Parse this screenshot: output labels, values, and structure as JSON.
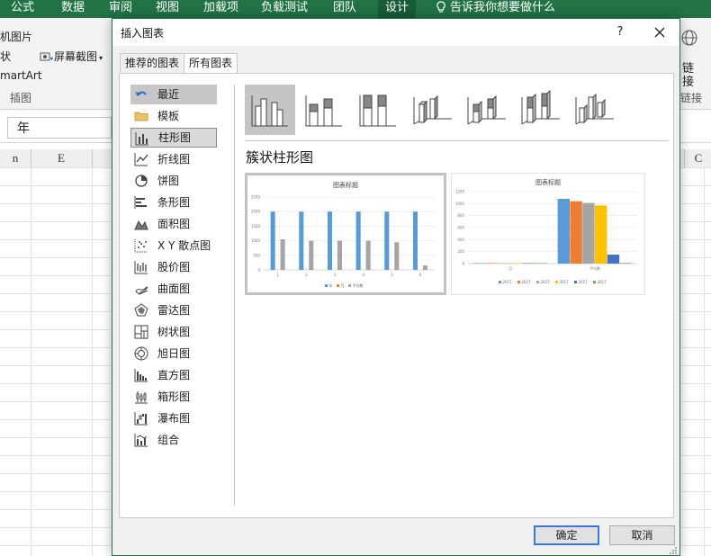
{
  "ribbon": {
    "tabs": [
      "公式",
      "数据",
      "审阅",
      "视图",
      "加载项",
      "负载测试",
      "团队",
      "设计"
    ],
    "tell_me": "告诉我你想要做什么",
    "left_items": [
      "机图片",
      "状",
      "屏幕截图",
      "martArt",
      "插图"
    ],
    "right_items": [
      "链",
      "接",
      "链接"
    ]
  },
  "formula_bar": {
    "namebox_value": "年"
  },
  "columns": [
    "n",
    "E"
  ],
  "right_col": "C",
  "dialog": {
    "title": "插入图表",
    "help": "?",
    "tabs": [
      "推荐的图表",
      "所有图表"
    ],
    "categories": [
      {
        "label": "最近",
        "icon": "undo-arrow-icon"
      },
      {
        "label": "模板",
        "icon": "folder-icon"
      },
      {
        "label": "柱形图",
        "icon": "column-chart-icon"
      },
      {
        "label": "折线图",
        "icon": "line-chart-icon"
      },
      {
        "label": "饼图",
        "icon": "pie-chart-icon"
      },
      {
        "label": "条形图",
        "icon": "bar-chart-icon"
      },
      {
        "label": "面积图",
        "icon": "area-chart-icon"
      },
      {
        "label": "X Y 散点图",
        "icon": "scatter-chart-icon"
      },
      {
        "label": "股价图",
        "icon": "stock-chart-icon"
      },
      {
        "label": "曲面图",
        "icon": "surface-chart-icon"
      },
      {
        "label": "雷达图",
        "icon": "radar-chart-icon"
      },
      {
        "label": "树状图",
        "icon": "treemap-chart-icon"
      },
      {
        "label": "旭日图",
        "icon": "sunburst-chart-icon"
      },
      {
        "label": "直方图",
        "icon": "histogram-chart-icon"
      },
      {
        "label": "箱形图",
        "icon": "box-whisker-icon"
      },
      {
        "label": "瀑布图",
        "icon": "waterfall-chart-icon"
      },
      {
        "label": "组合",
        "icon": "combo-chart-icon"
      }
    ],
    "subtype_title": "簇状柱形图",
    "buttons": {
      "ok": "确定",
      "cancel": "取消"
    }
  },
  "chart_data": [
    {
      "type": "bar",
      "title": "图表标题",
      "categories": [
        "1",
        "2",
        "3",
        "4",
        "5",
        "6"
      ],
      "series": [
        {
          "name": "年",
          "values": [
            2000,
            2000,
            2000,
            2000,
            2000,
            2000
          ],
          "color": "#5b9bd5"
        },
        {
          "name": "月",
          "values": [
            0,
            0,
            0,
            0,
            0,
            0
          ],
          "color": "#ed7d31"
        },
        {
          "name": "平均数",
          "values": [
            1050,
            1000,
            1000,
            1000,
            950,
            150
          ],
          "color": "#a5a5a5"
        }
      ],
      "ylim": [
        0,
        2500
      ],
      "yticks": [
        "0",
        "500",
        "1000",
        "1500",
        "2000",
        "2500"
      ],
      "grid": true,
      "legend": "bottom"
    },
    {
      "type": "bar",
      "title": "图表标题",
      "categories": [
        "月",
        "平均数"
      ],
      "series": [
        {
          "name": "2017",
          "values": [
            8,
            1080
          ],
          "color": "#5b9bd5"
        },
        {
          "name": "2017",
          "values": [
            8,
            1040
          ],
          "color": "#ed7d31"
        },
        {
          "name": "2017",
          "values": [
            8,
            1010
          ],
          "color": "#a5a5a5"
        },
        {
          "name": "2017",
          "values": [
            8,
            970
          ],
          "color": "#ffc000"
        },
        {
          "name": "2017",
          "values": [
            8,
            150
          ],
          "color": "#4472c4"
        },
        {
          "name": "2017",
          "values": [
            8,
            10
          ],
          "color": "#70ad47"
        }
      ],
      "ylim": [
        0,
        1200
      ],
      "yticks": [
        "0",
        "200",
        "400",
        "600",
        "800",
        "1000",
        "1200"
      ],
      "grid": true,
      "legend": "bottom"
    }
  ]
}
